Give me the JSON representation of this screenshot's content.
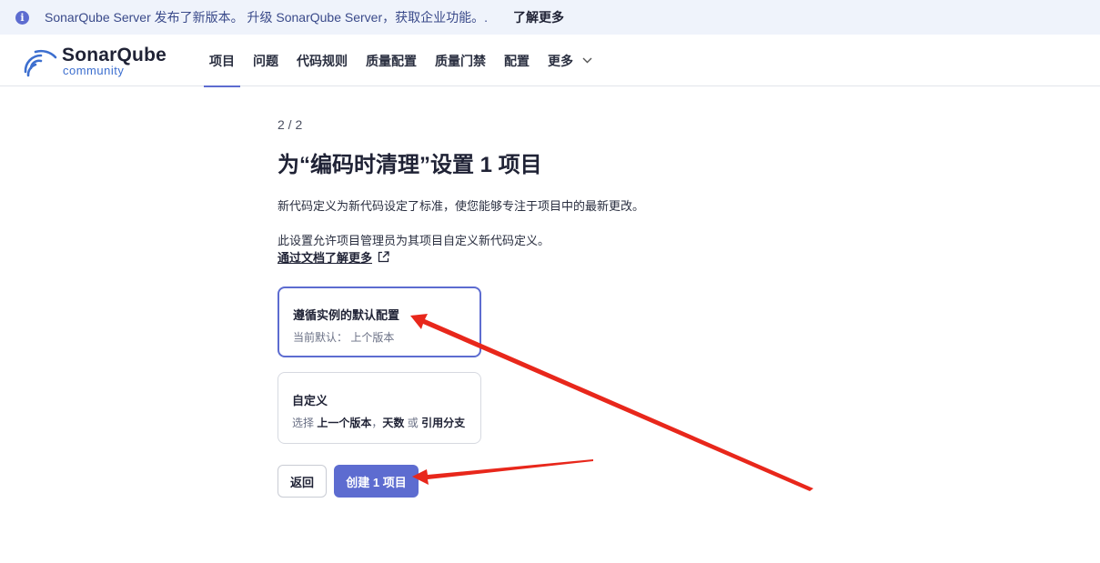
{
  "banner": {
    "icon": "info-icon",
    "message": "SonarQube Server 发布了新版本。 升级 SonarQube Server，获取企业功能。.",
    "learn_more": "了解更多"
  },
  "header": {
    "logo_name_a": "Sonar",
    "logo_name_b": "Qube",
    "logo_sub": "community",
    "nav": [
      {
        "label": "项目"
      },
      {
        "label": "问题"
      },
      {
        "label": "代码规则"
      },
      {
        "label": "质量配置"
      },
      {
        "label": "质量门禁"
      },
      {
        "label": "配置"
      },
      {
        "label": "更多"
      }
    ]
  },
  "main": {
    "step": "2 / 2",
    "title": "为“编码时清理”设置 1 项目",
    "desc1": "新代码定义为新代码设定了标准，使您能够专注于项目中的最新更改。",
    "desc2": "此设置允许项目管理员为其项目自定义新代码定义。",
    "doc_link": "通过文档了解更多",
    "option_default": {
      "title": "遵循实例的默认配置",
      "subtitle": "当前默认： 上个版本"
    },
    "option_custom": {
      "title": "自定义",
      "sub_prefix": "选择",
      "sub_a": "上一个版本",
      "sub_sep": "，",
      "sub_b": "天数",
      "sub_or": "或",
      "sub_c": "引用分支"
    },
    "back_label": "返回",
    "create_label": "创建 1 项目"
  },
  "colors": {
    "accent": "#5d6cd0",
    "banner_bg": "#eff3fb",
    "annotation": "#e8271b"
  }
}
